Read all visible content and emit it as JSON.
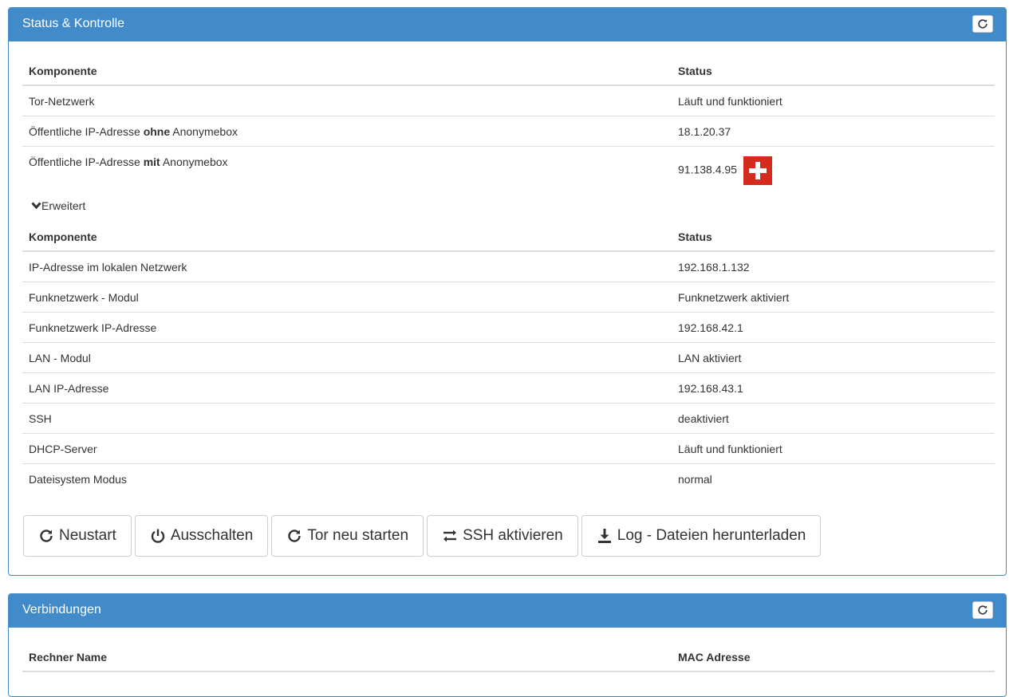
{
  "status_panel": {
    "title": "Status & Kontrolle",
    "columns": {
      "component": "Komponente",
      "status": "Status"
    },
    "rows": [
      {
        "component": "Tor-Netzwerk",
        "status": "Läuft und funktioniert"
      },
      {
        "component_pre": "Öffentliche IP-Adresse ",
        "component_bold": "ohne",
        "component_post": " Anonymebox",
        "status": "18.1.20.37"
      },
      {
        "component_pre": "Öffentliche IP-Adresse ",
        "component_bold": "mit",
        "component_post": " Anonymebox",
        "status": "91.138.4.95",
        "flag": "swiss-flag-icon"
      }
    ],
    "extended_label": "Erweitert",
    "extended_columns": {
      "component": "Komponente",
      "status": "Status"
    },
    "extended_rows": [
      {
        "component": "IP-Adresse im lokalen Netzwerk",
        "status": "192.168.1.132"
      },
      {
        "component": "Funknetzwerk - Modul",
        "status": "Funknetzwerk aktiviert"
      },
      {
        "component": "Funknetzwerk IP-Adresse",
        "status": "192.168.42.1"
      },
      {
        "component": "LAN - Modul",
        "status": "LAN aktiviert"
      },
      {
        "component": "LAN IP-Adresse",
        "status": "192.168.43.1"
      },
      {
        "component": "SSH",
        "status": "deaktiviert"
      },
      {
        "component": "DHCP-Server",
        "status": "Läuft und funktioniert"
      },
      {
        "component": "Dateisystem Modus",
        "status": "normal"
      }
    ],
    "buttons": [
      {
        "label": "Neustart",
        "icon": "refresh-icon"
      },
      {
        "label": "Ausschalten",
        "icon": "power-icon"
      },
      {
        "label": "Tor neu starten",
        "icon": "refresh-icon"
      },
      {
        "label": "SSH aktivieren",
        "icon": "swap-icon"
      },
      {
        "label": "Log - Dateien herunterladen",
        "icon": "download-icon"
      }
    ]
  },
  "connections_panel": {
    "title": "Verbindungen",
    "columns": {
      "host": "Rechner Name",
      "mac": "MAC Adresse"
    }
  },
  "colors": {
    "primary": "#428bca",
    "flag_red": "#d52b1e",
    "border": "#dddddd"
  }
}
